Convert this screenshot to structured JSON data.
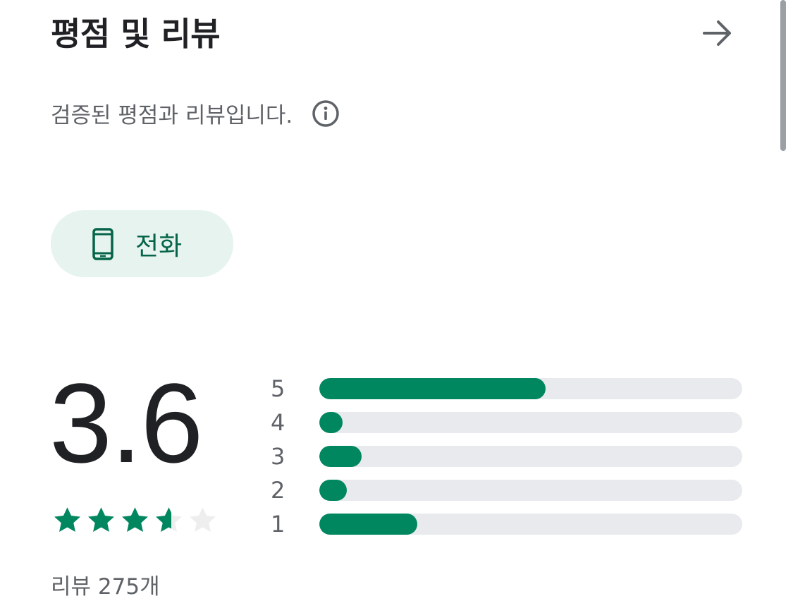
{
  "header": {
    "title": "평점 및 리뷰",
    "arrow_icon": "arrow-right-icon"
  },
  "verified": {
    "text": "검증된 평점과 리뷰입니다.",
    "info_icon": "info-icon"
  },
  "device_chip": {
    "label": "전화",
    "icon": "phone-icon",
    "selected": true
  },
  "rating": {
    "score": "3.6",
    "stars_value": 3.6,
    "stars_max": 5,
    "review_count": "리뷰 275개"
  },
  "histogram": [
    {
      "label": "5",
      "fraction": 0.535
    },
    {
      "label": "4",
      "fraction": 0.055
    },
    {
      "label": "3",
      "fraction": 0.1
    },
    {
      "label": "2",
      "fraction": 0.065
    },
    {
      "label": "1",
      "fraction": 0.232
    }
  ],
  "colors": {
    "accent": "#01875f",
    "chip_bg": "#e6f3ee",
    "chip_text": "#056449",
    "track": "#e8eaed",
    "text_primary": "#202124",
    "text_secondary": "#5f6368",
    "star_empty": "#eeeeee"
  }
}
